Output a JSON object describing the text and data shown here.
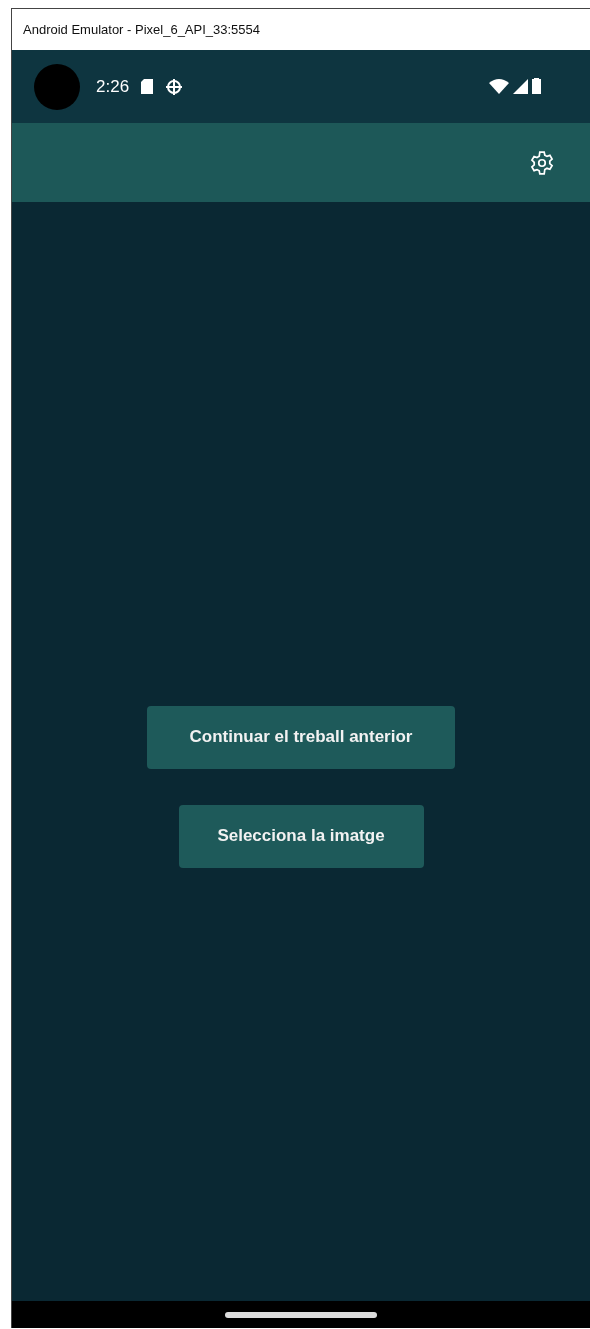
{
  "window": {
    "title": "Android Emulator - Pixel_6_API_33:5554"
  },
  "status_bar": {
    "time": "2:26"
  },
  "buttons": [
    {
      "label": "Continuar el treball anterior"
    },
    {
      "label": "Selecciona la imatge"
    }
  ]
}
